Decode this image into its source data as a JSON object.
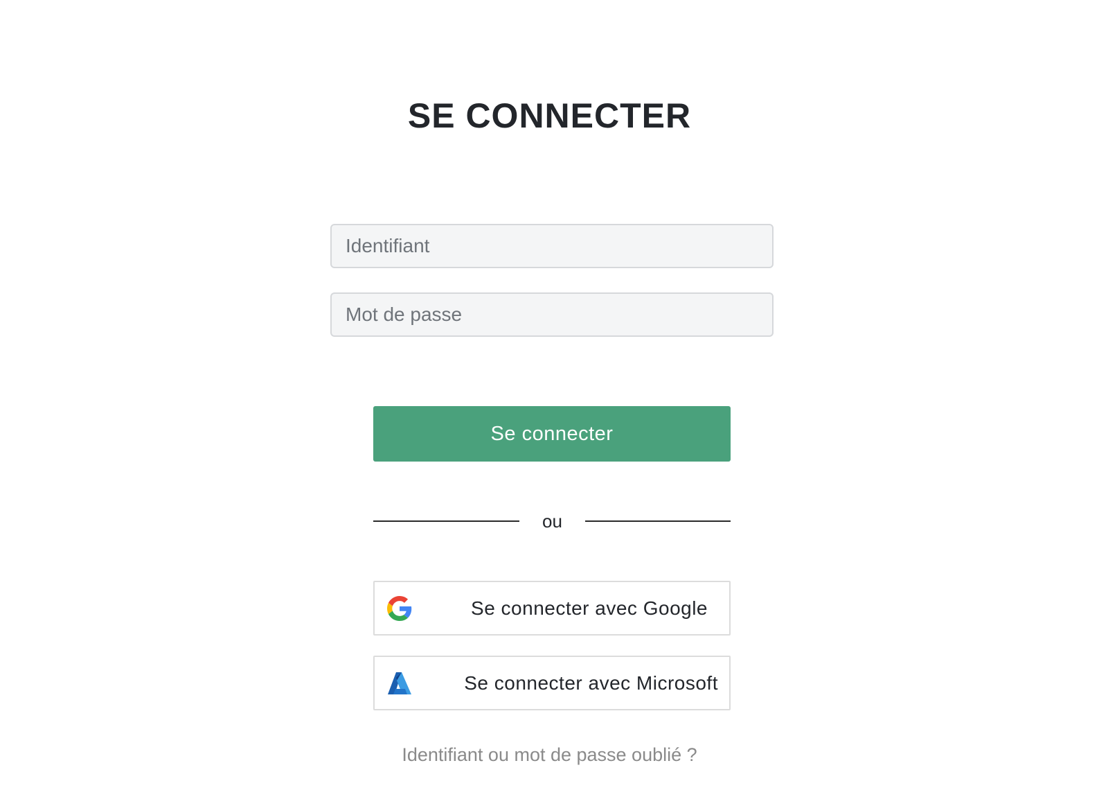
{
  "login": {
    "title": "SE CONNECTER",
    "username_placeholder": "Identifiant",
    "username_value": "",
    "password_placeholder": "Mot de passe",
    "password_value": "",
    "submit_label": "Se connecter",
    "divider_text": "ou",
    "google_button_label": "Se connecter avec Google",
    "microsoft_button_label": "Se connecter avec Microsoft",
    "forgot_link_label": "Identifiant ou mot de passe oublié ?"
  },
  "icons": {
    "google": "google-logo-icon",
    "microsoft": "azure-logo-icon"
  },
  "colors": {
    "primary_button": "#4aa17c",
    "title_text": "#23262b",
    "input_background": "#f4f5f6",
    "link_text": "#8a8a8a"
  }
}
